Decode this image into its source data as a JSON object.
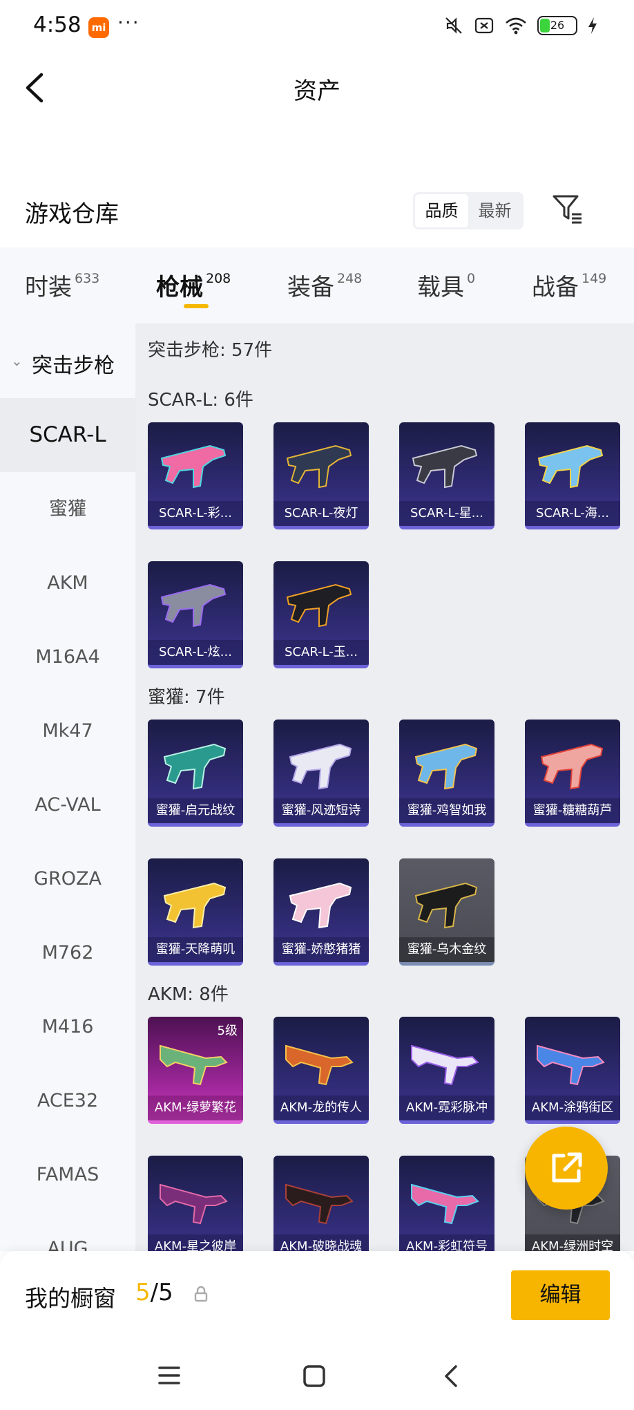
{
  "status_bar": {
    "time": "4:58",
    "mi_label": "mi",
    "more": "···",
    "battery": "26"
  },
  "header": {
    "title": "资产"
  },
  "warehouse": {
    "title": "游戏仓库",
    "sort_options": [
      "品质",
      "最新"
    ]
  },
  "tabs": [
    {
      "label": "时装",
      "count": "633"
    },
    {
      "label": "枪械",
      "count": "208"
    },
    {
      "label": "装备",
      "count": "248"
    },
    {
      "label": "载具",
      "count": "0"
    },
    {
      "label": "战备",
      "count": "149"
    }
  ],
  "sidebar": {
    "category": "突击步枪",
    "items": [
      "SCAR-L",
      "蜜獾",
      "AKM",
      "M16A4",
      "Mk47",
      "AC-VAL",
      "GROZA",
      "M762",
      "M416",
      "ACE32",
      "FAMAS",
      "AUG"
    ]
  },
  "content": {
    "summary": "突击步枪: 57件",
    "groups": [
      {
        "title": "SCAR-L: 6件",
        "items": [
          "SCAR-L-彩...",
          "SCAR-L-夜灯",
          "SCAR-L-星...",
          "SCAR-L-海...",
          "SCAR-L-炫...",
          "SCAR-L-玉..."
        ]
      },
      {
        "title": "蜜獾: 7件",
        "items": [
          "蜜獾-启元战纹",
          "蜜獾-风迹短诗",
          "蜜獾-鸡智如我",
          "蜜獾-糖糖葫芦",
          "蜜獾-天降萌叽",
          "蜜獾-娇憨猪猪",
          "蜜獾-乌木金纹"
        ]
      },
      {
        "title": "AKM: 8件",
        "items": [
          "AKM-绿萝繁花",
          "AKM-龙的传人",
          "AKM-霓彩脉冲",
          "AKM-涂鸦街区",
          "AKM-星之彼岸",
          "AKM-破晓战魂",
          "AKM-彩虹符号",
          "AKM-绿洲时空"
        ],
        "first_level": "5级"
      }
    ]
  },
  "bottom_bar": {
    "label": "我的橱窗",
    "count_current": "5",
    "count_total": "/5",
    "edit_label": "编辑"
  },
  "colors": {
    "accent": "#f7b500",
    "card_bg": "#2f2a72",
    "card_border": "#6c63d8"
  }
}
